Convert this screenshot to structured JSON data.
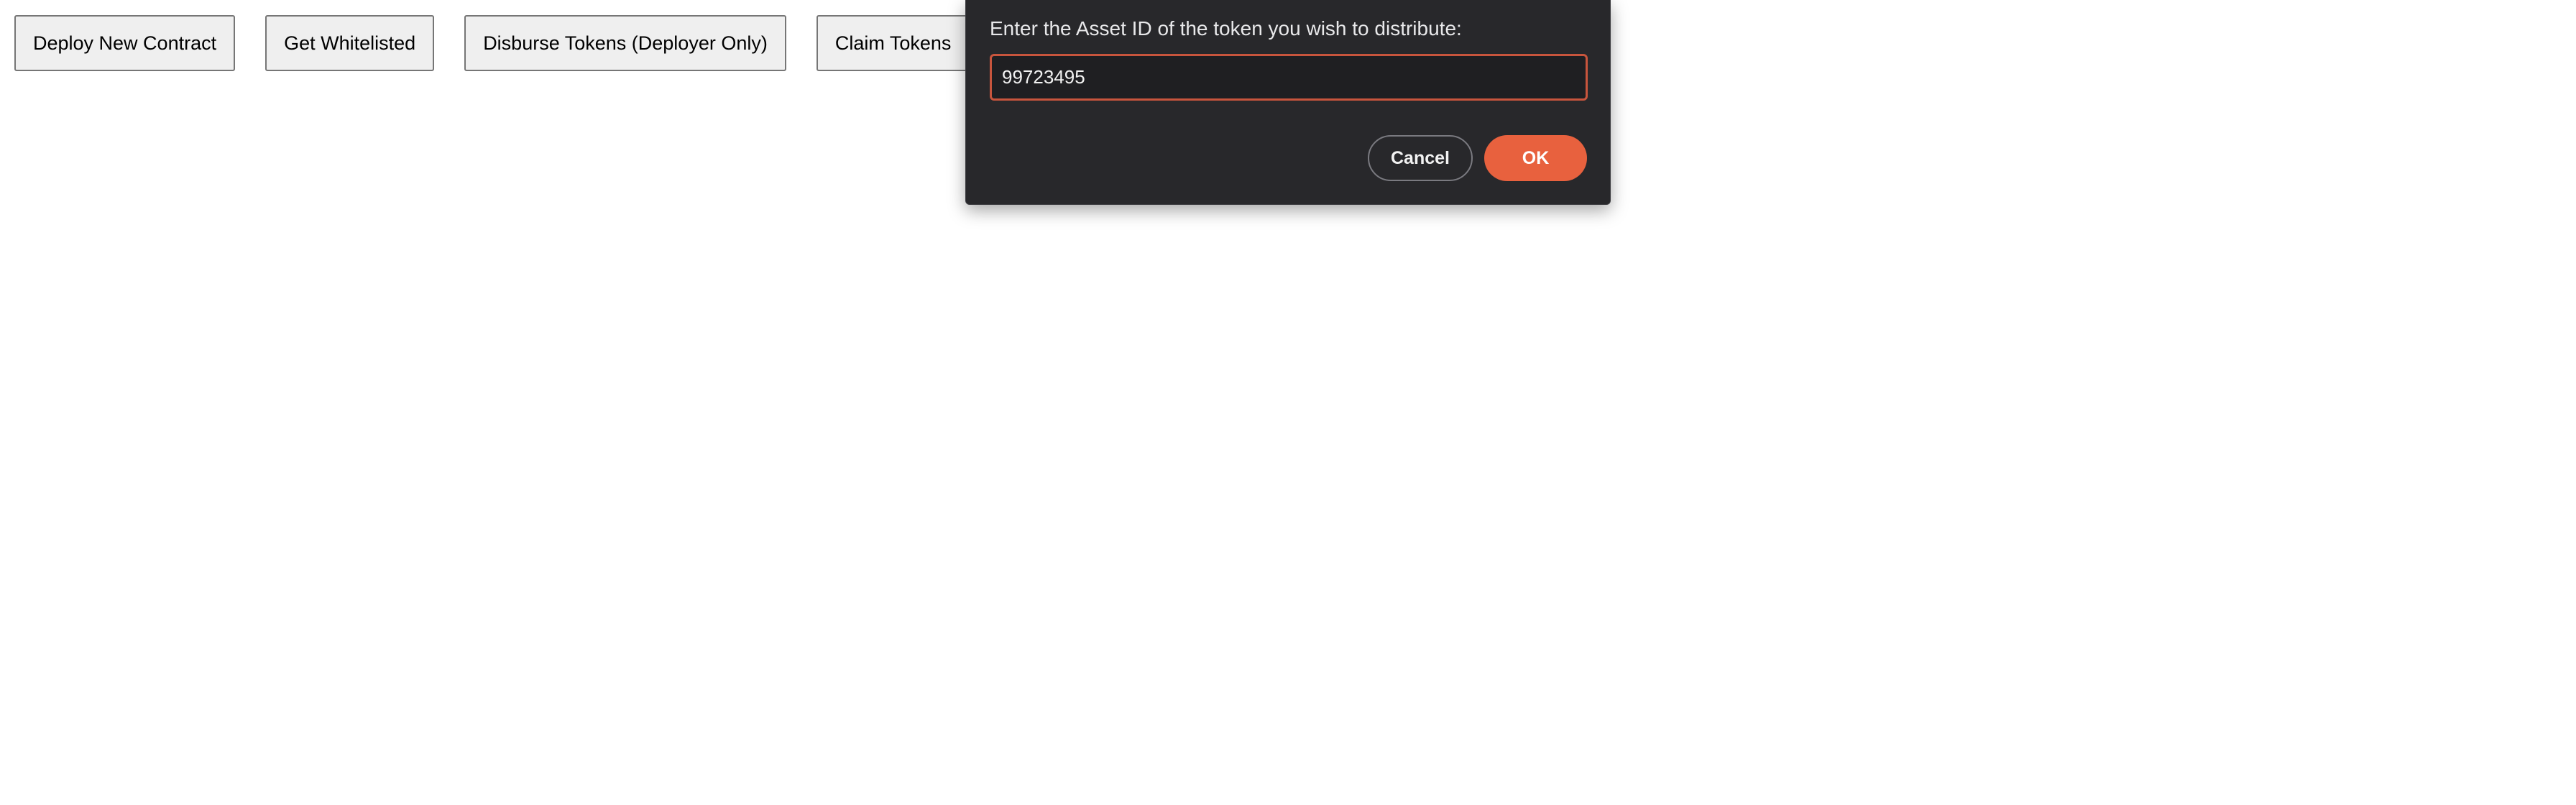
{
  "toolbar": {
    "buttons": [
      {
        "label": "Deploy New Contract"
      },
      {
        "label": "Get Whitelisted"
      },
      {
        "label": "Disburse Tokens (Deployer Only)"
      },
      {
        "label": "Claim Tokens"
      }
    ]
  },
  "dialog": {
    "message": "Enter the Asset ID of the token you wish to distribute:",
    "input_value": "99723495",
    "cancel_label": "Cancel",
    "ok_label": "OK"
  },
  "colors": {
    "dialog_background": "#28282b",
    "accent": "#e8613e",
    "input_focus_border": "#c8553d",
    "page_background": "#ffffff"
  }
}
